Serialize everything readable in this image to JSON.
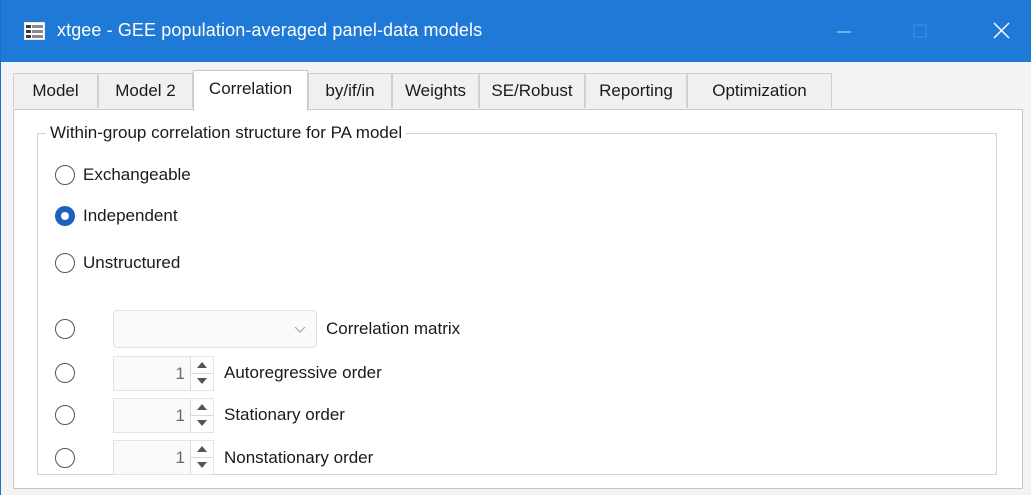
{
  "window": {
    "title": "xtgee - GEE population-averaged panel-data models",
    "icons": [
      "app-window-icon",
      "minimize-icon",
      "maximize-icon",
      "close-icon"
    ]
  },
  "tabs": [
    {
      "label": "Model"
    },
    {
      "label": "Model 2"
    },
    {
      "label": "Correlation",
      "active": true
    },
    {
      "label": "by/if/in"
    },
    {
      "label": "Weights"
    },
    {
      "label": "SE/Robust"
    },
    {
      "label": "Reporting"
    },
    {
      "label": "Optimization"
    }
  ],
  "group": {
    "legend": "Within-group correlation structure for PA model",
    "options": [
      {
        "label": "Exchangeable",
        "checked": false
      },
      {
        "label": "Independent",
        "checked": true
      },
      {
        "label": "Unstructured",
        "checked": false
      },
      {
        "label": "Correlation matrix",
        "checked": false,
        "control": "combo",
        "value": ""
      },
      {
        "label": "Autoregressive order",
        "checked": false,
        "control": "spinner",
        "value": "1"
      },
      {
        "label": "Stationary order",
        "checked": false,
        "control": "spinner",
        "value": "1"
      },
      {
        "label": "Nonstationary order",
        "checked": false,
        "control": "spinner",
        "value": "1"
      }
    ]
  },
  "colors": {
    "titlebar": "#1f79d6",
    "radio_checked": "#1f5fbf"
  }
}
